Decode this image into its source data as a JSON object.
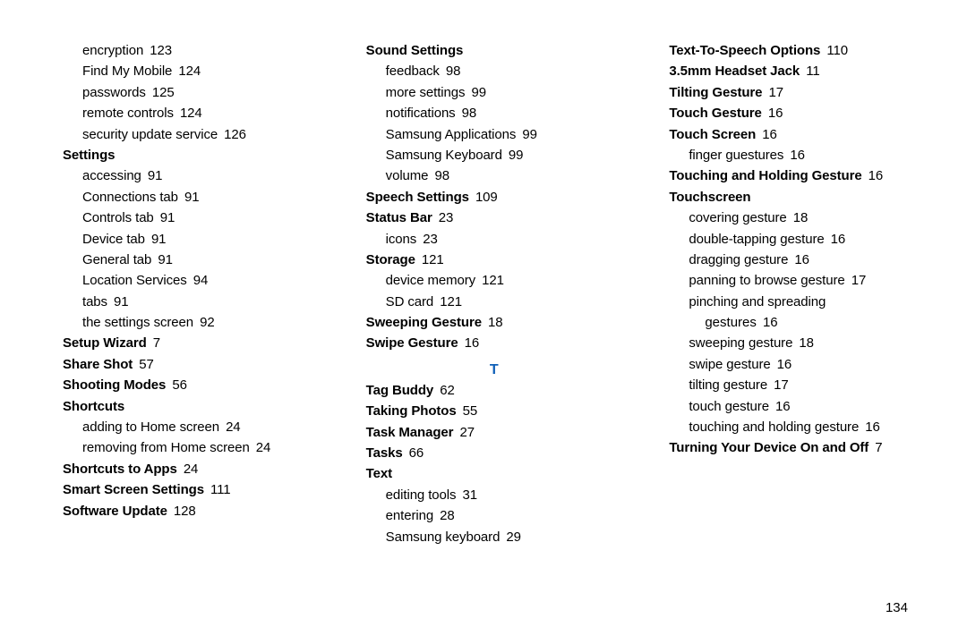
{
  "pagenum": "134",
  "sectionLetter": "T",
  "col1_pre": [
    {
      "t": "sub",
      "label": "encryption",
      "page": "123"
    },
    {
      "t": "sub",
      "label": "Find My Mobile",
      "page": "124"
    },
    {
      "t": "sub",
      "label": "passwords",
      "page": "125"
    },
    {
      "t": "sub",
      "label": "remote controls",
      "page": "124"
    },
    {
      "t": "sub",
      "label": "security update service",
      "page": "126"
    }
  ],
  "col1_main": [
    {
      "t": "bold",
      "label": "Settings",
      "page": ""
    },
    {
      "t": "sub",
      "label": "accessing",
      "page": "91"
    },
    {
      "t": "sub",
      "label": "Connections tab",
      "page": "91"
    },
    {
      "t": "sub",
      "label": "Controls tab",
      "page": "91"
    },
    {
      "t": "sub",
      "label": "Device tab",
      "page": "91"
    },
    {
      "t": "sub",
      "label": "General tab",
      "page": "91"
    },
    {
      "t": "sub",
      "label": "Location Services",
      "page": "94"
    },
    {
      "t": "sub",
      "label": "tabs",
      "page": "91"
    },
    {
      "t": "sub",
      "label": "the settings screen",
      "page": "92"
    },
    {
      "t": "bold",
      "label": "Setup Wizard",
      "page": "7"
    },
    {
      "t": "bold",
      "label": "Share Shot",
      "page": "57"
    },
    {
      "t": "bold",
      "label": "Shooting Modes",
      "page": "56"
    },
    {
      "t": "bold",
      "label": "Shortcuts",
      "page": ""
    },
    {
      "t": "sub",
      "label": "adding to Home screen",
      "page": "24"
    },
    {
      "t": "sub",
      "label": "removing from Home screen",
      "page": "24"
    },
    {
      "t": "bold",
      "label": "Shortcuts to Apps",
      "page": "24"
    },
    {
      "t": "bold",
      "label": "Smart Screen Settings",
      "page": "111"
    },
    {
      "t": "bold",
      "label": "Software Update",
      "page": "128"
    }
  ],
  "col2_top": [
    {
      "t": "bold",
      "label": "Sound Settings",
      "page": ""
    },
    {
      "t": "sub",
      "label": "feedback",
      "page": "98"
    },
    {
      "t": "sub",
      "label": "more settings",
      "page": "99"
    },
    {
      "t": "sub",
      "label": "notifications",
      "page": "98"
    },
    {
      "t": "sub",
      "label": "Samsung Applications",
      "page": "99"
    },
    {
      "t": "sub",
      "label": "Samsung Keyboard",
      "page": "99"
    },
    {
      "t": "sub",
      "label": "volume",
      "page": "98"
    },
    {
      "t": "bold",
      "label": "Speech Settings",
      "page": "109"
    },
    {
      "t": "bold",
      "label": "Status Bar",
      "page": "23"
    },
    {
      "t": "sub",
      "label": "icons",
      "page": "23"
    },
    {
      "t": "bold",
      "label": "Storage",
      "page": "121"
    },
    {
      "t": "sub",
      "label": "device memory",
      "page": "121"
    },
    {
      "t": "sub",
      "label": "SD card",
      "page": "121"
    },
    {
      "t": "bold",
      "label": "Sweeping Gesture",
      "page": "18"
    },
    {
      "t": "bold",
      "label": "Swipe Gesture",
      "page": "16"
    }
  ],
  "col2_bottom": [
    {
      "t": "bold",
      "label": "Tag Buddy",
      "page": "62"
    },
    {
      "t": "bold",
      "label": "Taking Photos",
      "page": "55"
    },
    {
      "t": "bold",
      "label": "Task Manager",
      "page": "27"
    },
    {
      "t": "bold",
      "label": "Tasks",
      "page": "66"
    },
    {
      "t": "bold",
      "label": "Text",
      "page": ""
    },
    {
      "t": "sub",
      "label": "editing tools",
      "page": "31"
    },
    {
      "t": "sub",
      "label": "entering",
      "page": "28"
    },
    {
      "t": "sub",
      "label": "Samsung keyboard",
      "page": "29"
    }
  ],
  "col3": [
    {
      "t": "bold",
      "label": "Text-To-Speech Options",
      "page": "110"
    },
    {
      "t": "bold",
      "label": "3.5mm Headset Jack",
      "page": "11"
    },
    {
      "t": "bold",
      "label": "Tilting Gesture",
      "page": "17"
    },
    {
      "t": "bold",
      "label": "Touch Gesture",
      "page": "16"
    },
    {
      "t": "bold",
      "label": "Touch Screen",
      "page": "16"
    },
    {
      "t": "sub",
      "label": "finger guestures",
      "page": "16"
    },
    {
      "t": "bold",
      "label": "Touching and Holding Gesture",
      "page": "16"
    },
    {
      "t": "bold",
      "label": "Touchscreen",
      "page": ""
    },
    {
      "t": "sub",
      "label": "covering gesture",
      "page": "18"
    },
    {
      "t": "sub",
      "label": "double-tapping gesture",
      "page": "16"
    },
    {
      "t": "sub",
      "label": "dragging gesture",
      "page": "16"
    },
    {
      "t": "sub",
      "label": "panning to browse gesture",
      "page": "17"
    },
    {
      "t": "sub",
      "label": "pinching and spreading",
      "page": ""
    },
    {
      "t": "sub2",
      "label": "gestures",
      "page": "16"
    },
    {
      "t": "sub",
      "label": "sweeping gesture",
      "page": "18"
    },
    {
      "t": "sub",
      "label": "swipe gesture",
      "page": "16"
    },
    {
      "t": "sub",
      "label": "tilting gesture",
      "page": "17"
    },
    {
      "t": "sub",
      "label": "touch gesture",
      "page": "16"
    },
    {
      "t": "sub",
      "label": "touching and holding gesture",
      "page": "16"
    },
    {
      "t": "bold",
      "label": "Turning Your Device On and Off",
      "page": "7"
    }
  ]
}
